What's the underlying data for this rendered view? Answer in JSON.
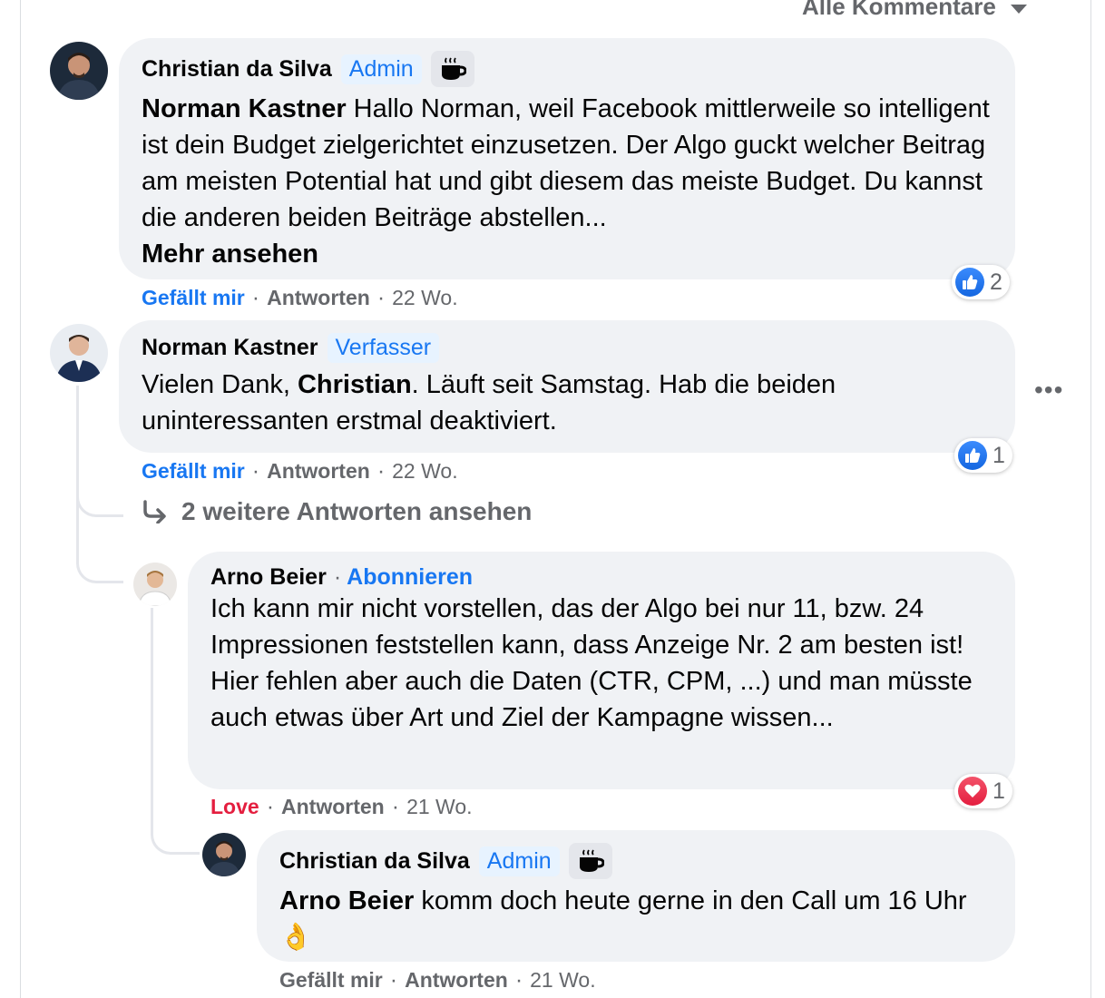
{
  "sort_label": "Alle Kommentare",
  "comments": [
    {
      "author": "Christian da Silva",
      "badge": "Admin",
      "mention": "Norman Kastner",
      "text": " Hallo Norman, weil Facebook mittlerweile so intelligent ist dein Budget zielgerichtet einzusetzen. Der Algo guckt welcher Beitrag am meisten Potential hat und gibt diesem das meiste Budget. Du kannst die anderen beiden Beiträge abstellen...",
      "see_more": "Mehr ansehen",
      "like_label": "Gefällt mir",
      "reply_label": "Antworten",
      "time": "22 Wo.",
      "reaction_count": "2"
    },
    {
      "author": "Norman Kastner",
      "badge": "Verfasser",
      "text_before": "Vielen Dank, ",
      "mention": "Christian",
      "text_after": ". Läuft seit Samstag. Hab die beiden uninteressanten erstmal deaktiviert.",
      "like_label": "Gefällt mir",
      "reply_label": "Antworten",
      "time": "22 Wo.",
      "reaction_count": "1"
    },
    {
      "author": "Arno Beier",
      "follow_label": "Abonnieren",
      "line1": "Ich kann mir nicht vorstellen, das der Algo bei nur 11, bzw. 24 Impressionen feststellen kann, dass Anzeige Nr. 2 am besten ist!",
      "line2": "Hier fehlen aber auch die Daten (CTR, CPM, ...) und man müsste auch etwas über Art und Ziel der Kampagne wissen...",
      "like_label": "Love",
      "reply_label": "Antworten",
      "time": "21 Wo.",
      "reaction_count": "1"
    },
    {
      "author": "Christian da Silva",
      "badge": "Admin",
      "mention": "Arno Beier",
      "text": " komm doch heute gerne in den Call um 16 Uhr",
      "emoji": "👌",
      "like_label": "Gefällt mir",
      "reply_label": "Antworten",
      "time": "21 Wo."
    }
  ],
  "more_replies_label": "2 weitere Antworten ansehen",
  "separator": "·"
}
